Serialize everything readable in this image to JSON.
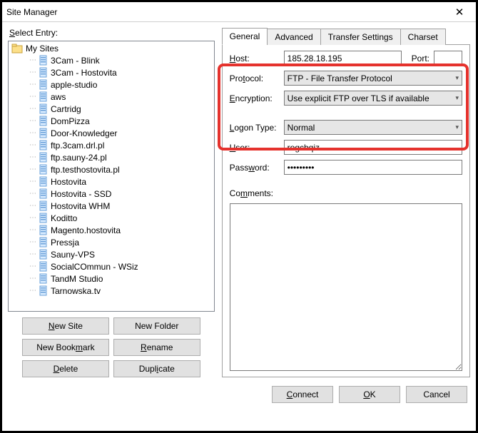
{
  "window": {
    "title": "Site Manager"
  },
  "left": {
    "select_label": "Select Entry:",
    "root": "My Sites",
    "sites": [
      "3Cam - Blink",
      "3Cam - Hostovita",
      "apple-studio",
      "aws",
      "Cartridg",
      "DomPizza",
      "Door-Knowledger",
      "ftp.3cam.drl.pl",
      "ftp.sauny-24.pl",
      "ftp.testhostovita.pl",
      "Hostovita",
      "Hostovita - SSD",
      "Hostovita WHM",
      "Koditto",
      "Magento.hostovita",
      "Pressja",
      "Sauny-VPS",
      "SocialCOmmun - WSiz",
      "TandM Studio",
      "Tarnowska.tv"
    ],
    "buttons": {
      "new_site": "New Site",
      "new_folder": "New Folder",
      "new_bookmark": "New Bookmark",
      "rename": "Rename",
      "delete": "Delete",
      "duplicate": "Duplicate"
    }
  },
  "tabs": {
    "general": "General",
    "advanced": "Advanced",
    "transfer": "Transfer Settings",
    "charset": "Charset"
  },
  "form": {
    "host_label": "Host:",
    "host": "185.28.18.195",
    "port_label": "Port:",
    "port": "",
    "protocol_label": "Protocol:",
    "protocol": "FTP - File Transfer Protocol",
    "encryption_label": "Encryption:",
    "encryption": "Use explicit FTP over TLS if available",
    "logon_label": "Logon Type:",
    "logon": "Normal",
    "user_label": "User:",
    "user": "rogcbqiz",
    "password_label": "Password:",
    "password": "•••••••••",
    "comments_label": "Comments:"
  },
  "footer": {
    "connect": "Connect",
    "ok": "OK",
    "cancel": "Cancel"
  }
}
